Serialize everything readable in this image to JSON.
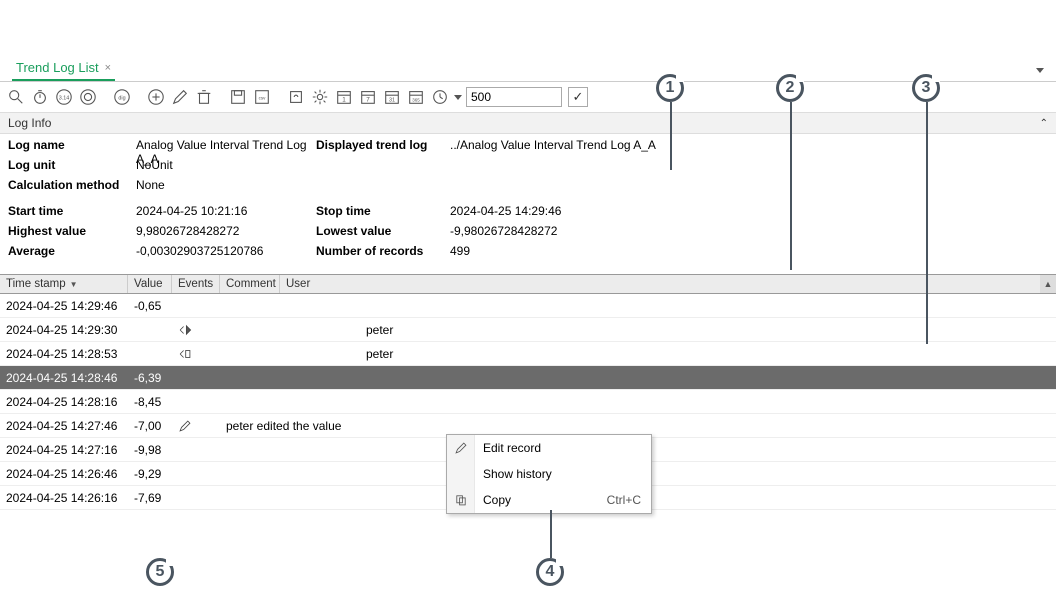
{
  "tab": {
    "title": "Trend Log List",
    "close_icon": "×"
  },
  "toolbar": {
    "input_value": "500",
    "check": "✓"
  },
  "section": {
    "title": "Log Info"
  },
  "info": {
    "log_name_l": "Log name",
    "log_name_v": "Analog Value Interval Trend Log A_A",
    "displayed_l": "Displayed trend log",
    "displayed_v": "../Analog Value Interval Trend Log A_A",
    "log_unit_l": "Log unit",
    "log_unit_v": "NoUnit",
    "calc_l": "Calculation method",
    "calc_v": "None",
    "start_l": "Start time",
    "start_v": "2024-04-25 10:21:16",
    "stop_l": "Stop time",
    "stop_v": "2024-04-25 14:29:46",
    "high_l": "Highest value",
    "high_v": "9,98026728428272",
    "low_l": "Lowest value",
    "low_v": "-9,98026728428272",
    "avg_l": "Average",
    "avg_v": "-0,00302903725120786",
    "num_l": "Number of records",
    "num_v": "499"
  },
  "columns": {
    "ts": "Time stamp",
    "val": "Value",
    "ev": "Events",
    "com": "Comment",
    "user": "User"
  },
  "rows": [
    {
      "ts": "2024-04-25 14:29:46",
      "val": "-0,65",
      "ev": "",
      "com": "",
      "user": ""
    },
    {
      "ts": "2024-04-25 14:29:30",
      "val": "",
      "ev": "icon1",
      "com": "",
      "user": "peter"
    },
    {
      "ts": "2024-04-25 14:28:53",
      "val": "",
      "ev": "icon2",
      "com": "",
      "user": "peter"
    },
    {
      "ts": "2024-04-25 14:28:46",
      "val": "-6,39",
      "ev": "",
      "com": "",
      "user": "",
      "sel": true
    },
    {
      "ts": "2024-04-25 14:28:16",
      "val": "-8,45",
      "ev": "",
      "com": "",
      "user": ""
    },
    {
      "ts": "2024-04-25 14:27:46",
      "val": "-7,00",
      "ev": "pencil",
      "com": "peter edited the value",
      "user": ""
    },
    {
      "ts": "2024-04-25 14:27:16",
      "val": "-9,98",
      "ev": "",
      "com": "",
      "user": ""
    },
    {
      "ts": "2024-04-25 14:26:46",
      "val": "-9,29",
      "ev": "",
      "com": "",
      "user": ""
    },
    {
      "ts": "2024-04-25 14:26:16",
      "val": "-7,69",
      "ev": "",
      "com": "",
      "user": ""
    }
  ],
  "menu": {
    "edit": "Edit record",
    "history": "Show history",
    "copy": "Copy",
    "copy_sc": "Ctrl+C"
  },
  "callouts": {
    "c1": "1",
    "c2": "2",
    "c3": "3",
    "c4": "4",
    "c5": "5"
  }
}
